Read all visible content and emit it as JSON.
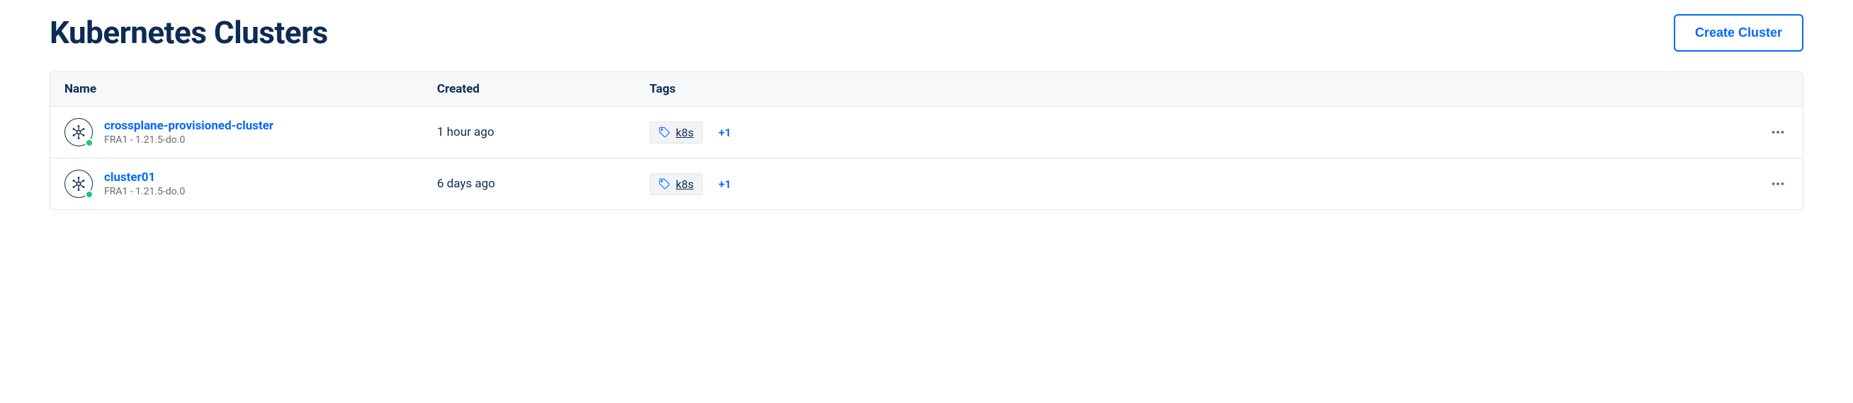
{
  "header": {
    "title": "Kubernetes Clusters",
    "create_button": "Create Cluster"
  },
  "columns": {
    "name": "Name",
    "created": "Created",
    "tags": "Tags"
  },
  "clusters": [
    {
      "name": "crossplane-provisioned-cluster",
      "meta": "FRA1 - 1.21.5-do.0",
      "created": "1 hour ago",
      "tag": "k8s",
      "tag_more": "+1"
    },
    {
      "name": "cluster01",
      "meta": "FRA1 - 1.21.5-do.0",
      "created": "6 days ago",
      "tag": "k8s",
      "tag_more": "+1"
    }
  ]
}
